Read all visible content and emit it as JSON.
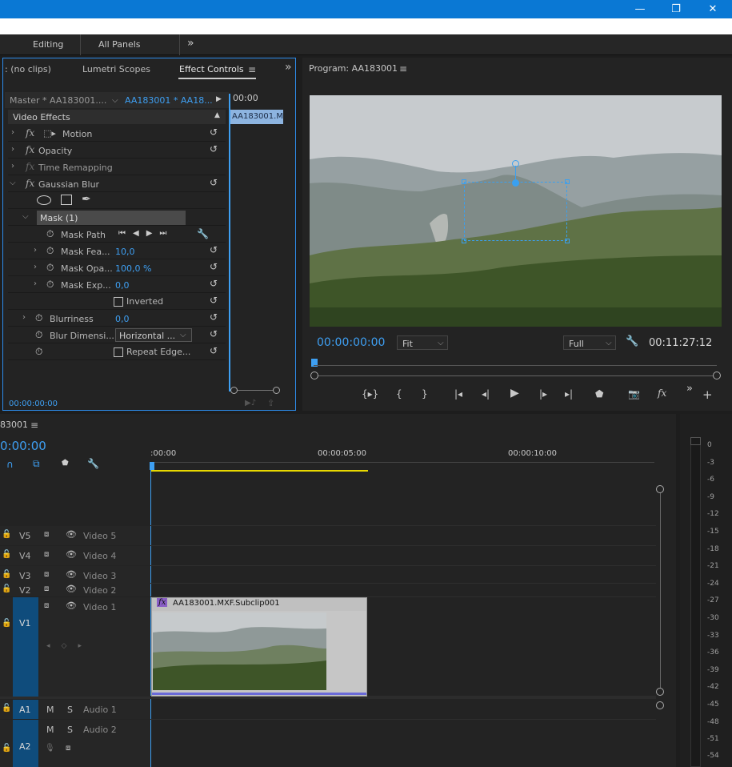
{
  "window": {
    "minimize": "—",
    "restore": "❐",
    "close": "✕"
  },
  "workspace": {
    "tabs": [
      "Editing",
      "All Panels"
    ],
    "more": "»"
  },
  "effect_controls": {
    "tabs": [
      ": (no clips)",
      "Lumetri Scopes",
      "Effect Controls"
    ],
    "menu": "≡",
    "more": "»",
    "master_label": "Master * AA183001....",
    "clip_label": "AA183001 * AA18...",
    "timeline_ruler": "00:00",
    "clip_block": "AA183001.M",
    "section": "Video Effects",
    "effects": {
      "motion": "Motion",
      "opacity": "Opacity",
      "time_remap": "Time Remapping",
      "gaussian": "Gaussian Blur"
    },
    "mask": {
      "name": "Mask (1)",
      "path": "Mask Path",
      "feather": "Mask Fea...",
      "feather_val": "10,0",
      "opacity": "Mask Opa...",
      "opacity_val": "100,0 %",
      "expansion": "Mask Exp...",
      "expansion_val": "0,0",
      "inverted": "Inverted"
    },
    "blurriness": "Blurriness",
    "blurriness_val": "0,0",
    "blur_dim": "Blur Dimensi...",
    "blur_dim_val": "Horizontal ...",
    "repeat": "Repeat Edge...",
    "timecode": "00:00:00:00"
  },
  "program": {
    "title": "Program: AA183001",
    "menu": "≡",
    "timecode": "00:00:00:00",
    "fit": "Fit",
    "full": "Full",
    "duration": "00:11:27:12",
    "more": "»",
    "add": "+"
  },
  "timeline": {
    "title": "83001",
    "menu": "≡",
    "timecode": "0:00:00",
    "ruler": [
      ":00:00",
      "00:00:05:00",
      "00:00:10:00"
    ],
    "tracks": {
      "v5": "V5",
      "v4": "V4",
      "v3": "V3",
      "v2": "V2",
      "v1": "V1",
      "a1": "A1",
      "a2": "A2"
    },
    "names": {
      "v5": "Video 5",
      "v4": "Video 4",
      "v3": "Video 3",
      "v2": "Video 2",
      "v1": "Video 1",
      "a1": "Audio 1",
      "a2": "Audio 2"
    },
    "mute": "M",
    "solo": "S",
    "clip": "AA183001.MXF.Subclip001"
  },
  "meter": {
    "labels": [
      "0",
      "-3",
      "-6",
      "-9",
      "-12",
      "-15",
      "-18",
      "-21",
      "-24",
      "-27",
      "-30",
      "-33",
      "-36",
      "-39",
      "-42",
      "-45",
      "-48",
      "-51",
      "-54"
    ]
  },
  "colors": {
    "accent": "#2d8ceb",
    "titlebar": "#0a78d4",
    "timecode": "#3e9ff2"
  }
}
